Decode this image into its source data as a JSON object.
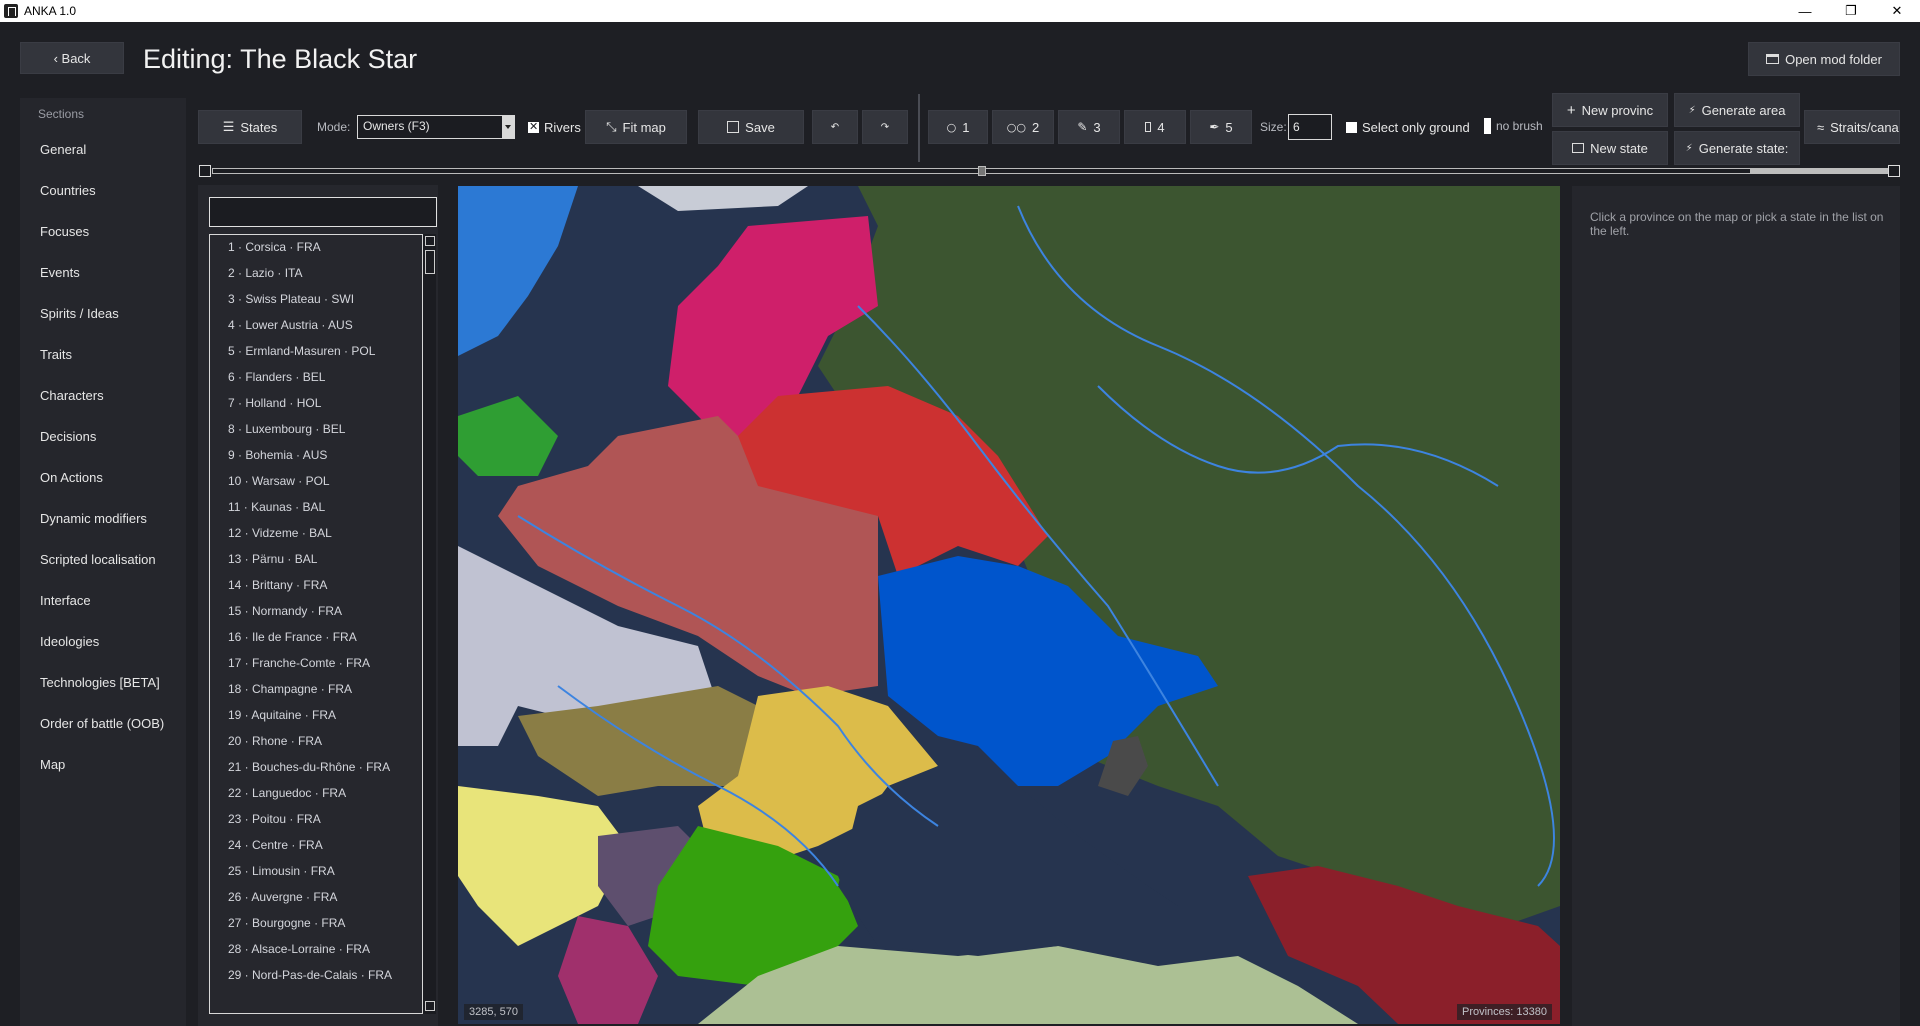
{
  "window": {
    "title": "ANKA 1.0"
  },
  "header": {
    "back_label": "‹ Back",
    "page_title": "Editing: The Black Star",
    "open_mod_label": "Open mod folder"
  },
  "sidebar": {
    "section_title": "Sections",
    "items": [
      "General",
      "Countries",
      "Focuses",
      "Events",
      "Spirits / Ideas",
      "Traits",
      "Characters",
      "Decisions",
      "On Actions",
      "Dynamic modifiers",
      "Scripted localisation",
      "Interface",
      "Ideologies",
      "Technologies [BETA]",
      "Order of battle (OOB)",
      "Map"
    ]
  },
  "toolbar": {
    "states_label": "States",
    "mode_label": "Mode:",
    "mode_value": "Owners (F3)",
    "rivers_label": "Rivers",
    "rivers_checked": true,
    "fit_map_label": "Fit map",
    "save_label": "Save",
    "brushes": [
      "1",
      "2",
      "3",
      "4",
      "5"
    ],
    "size_label": "Size:",
    "size_value": "6",
    "select_only_ground_label": "Select only ground",
    "no_brush_label": "no brush",
    "new_province_label": "New provinc",
    "new_state_label": "New state",
    "generate_area_label": "Generate area",
    "generate_states_label": "Generate state:",
    "straits_label": "Straits/canal"
  },
  "states_list": [
    "1 · Corsica · FRA",
    "2 · Lazio · ITA",
    "3 · Swiss Plateau · SWI",
    "4 · Lower Austria · AUS",
    "5 · Ermland-Masuren · POL",
    "6 · Flanders · BEL",
    "7 · Holland · HOL",
    "8 · Luxembourg · BEL",
    "9 · Bohemia · AUS",
    "10 · Warsaw · POL",
    "11 · Kaunas · BAL",
    "12 · Vidzeme · BAL",
    "13 · Pärnu · BAL",
    "14 · Brittany · FRA",
    "15 · Normandy · FRA",
    "16 · Ile de France · FRA",
    "17 · Franche-Comte · FRA",
    "18 · Champagne · FRA",
    "19 · Aquitaine · FRA",
    "20 · Rhone · FRA",
    "21 · Bouches-du-Rhône · FRA",
    "22 · Languedoc · FRA",
    "23 · Poitou · FRA",
    "24 · Centre · FRA",
    "25 · Limousin · FRA",
    "26 · Auvergne · FRA",
    "27 · Bourgogne · FRA",
    "28 · Alsace-Lorraine · FRA",
    "29 · Nord-Pas-de-Calais · FRA"
  ],
  "map": {
    "coords": "3285, 570",
    "provinces": "Provinces: 13380",
    "colors": {
      "sea": "#26344f",
      "russia": "#3c5530",
      "poland": "#cc3131",
      "baltic": "#cf1f6a",
      "germany": "#b05555",
      "ukraine": "#0055cc",
      "austria": "#8a7d45",
      "hungary": "#dcbc4a",
      "turkey": "#acc094",
      "georgia": "#8b1f2a"
    }
  },
  "right_panel": {
    "hint": "Click a province on the map or pick a state in the list on the left."
  }
}
